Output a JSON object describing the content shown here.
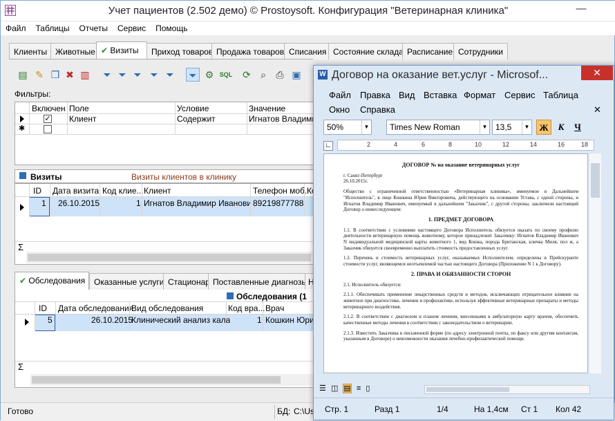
{
  "app": {
    "title": "Учет пациентов (2.502 демо) © Prostoysoft. Конфигурация \"Ветеринарная клиника\"",
    "minimize": "—",
    "close": "✕",
    "menu": [
      "Файл",
      "Таблицы",
      "Отчеты",
      "Сервис",
      "Помощь"
    ]
  },
  "tabs": [
    "Клиенты",
    "Животные",
    "Визиты",
    "Приход товаров",
    "Продажа товаров",
    "Списания",
    "Состояние склада",
    "Расписание",
    "Сотрудники"
  ],
  "active_tab_mark": "✔",
  "filters": {
    "label": "Фильтры:",
    "headers": [
      "Включен",
      "Поле",
      "Условие",
      "Значение"
    ],
    "row": {
      "checked": "✓",
      "field": "Клиент",
      "condition": "Содержит",
      "value": "Игнатов Владимир"
    },
    "new_row_marker": "✱"
  },
  "visits": {
    "title": "Визиты",
    "subtitle": "Визиты клиентов в клинику",
    "headers": [
      "ID",
      "Дата визита",
      "Код клие...",
      "Клиент",
      "Телефон моб.",
      "Ко"
    ],
    "row": {
      "id": "1",
      "date": "26.10.2015",
      "code": "1",
      "client": "Игнатов Владимир Иванович",
      "phone": "89219877788"
    },
    "sum_marker": "Σ"
  },
  "lower_tabs": [
    "Обследования",
    "Оказанные услуги",
    "Стационар",
    "Поставленные диагнозы",
    "Н"
  ],
  "exams": {
    "title": "Обследования (1",
    "headers": [
      "ID",
      "Дата обследования",
      "Вид обследования",
      "Код вра...",
      "Врач"
    ],
    "row": {
      "id": "5",
      "date": "26.10.2015",
      "type": "Клинический анализ кала",
      "code": "1",
      "doctor": "Кошкин Юрий"
    },
    "sum_marker": "Σ"
  },
  "statusbar": {
    "left": "Готово",
    "db_label": "БД:",
    "db_value": "C:\\Us"
  },
  "word": {
    "title": "Договор на оказание вет.услуг - Microsof...",
    "close": "✕",
    "menu_row1": [
      "Файл",
      "Правка",
      "Вид",
      "Вставка",
      "Формат",
      "Сервис",
      "Таблица"
    ],
    "menu_row2": [
      "Окно",
      "Справка"
    ],
    "menu_close": "✕",
    "zoom": "50%",
    "font": "Times New Roman",
    "size": "13,5",
    "bold": "Ж",
    "italic": "К",
    "underline": "Ч",
    "ruler_numbers": [
      "2",
      "4",
      "6",
      "8",
      "10",
      "12",
      "14",
      "16",
      "18"
    ],
    "doc": {
      "title": "ДОГОВОР № на оказание ветеринарных услуг",
      "city": "г. Санкт-Петербург",
      "date": "26.10.2015г.",
      "intro": "Общество с ограниченной ответственностью «Ветеринарная клиника», именуемое в Дальнейшем \"Исполнитель\", в лице Кошкина Юрия Викторовича, действующего на основании Устава, с одной стороны, и Игнатов Владимир Иванович, именуемый в дальнейшем \"Заказчик\", с другой стороны, заключили настоящий Договор о нижеследующем:",
      "h1": "1. ПРЕДМЕТ ДОГОВОРА",
      "p11": "1.1. В соответствии с условиями настоящего Договора Исполнитель обязуется оказать по своему профилю деятельности ветеринарную помощь животному, которое принадлежит Заказчику: Игнатов Владимир Иванович N индивидуальной медицинской карты животного 1, вид Кошка, порода Британская, кличка Миля, пол ж, а Заказчик обязуется своевременно выплатить стоимость предоставленных услуг.",
      "p12": "1.2. Перечень и стоимость ветеринарных услуг, оказываемых Исполнителем, определены в Прейскуранте стоимости услуг, являющемся неотъемлемой частью настоящего Договора (Приложение N 1 к Договору).",
      "h2": "2. ПРАВА И ОБЯЗАННОСТИ СТОРОН",
      "p21": "2.1. Исполнитель обязуется:",
      "p211": "2.1.1. Обеспечивать применение лекарственных средств и методов, исключающих отрицательное влияние на животное при диагностике, лечении и профилактике, используя эффективные ветеринарные препараты и методы ветеринарного воздействия.",
      "p212": "2.1.2. В соответствии с диагнозом и планом лечения, внесенными в амбулаторную карту врачом, обеспечить качественные методы лечения в соответствии с законодательством о ветеринарии.",
      "p213": "2.1.3. Известить Заказчика в письменной форме (по адресу электронной почты, по факсу или другим контактам, указанным в Договоре) о невозможности оказания лечебно-профилактической помощи."
    },
    "status": {
      "page": "Стр. 1",
      "section": "Разд 1",
      "pages": "1/4",
      "at": "На 1,4см",
      "line": "Ст 1",
      "col": "Кол 42"
    }
  },
  "colors": {
    "accent_orange": "#f7c56b",
    "selection": "#cfe3f8",
    "word_frame": "#dde8f5",
    "close_red": "#c7312b"
  }
}
